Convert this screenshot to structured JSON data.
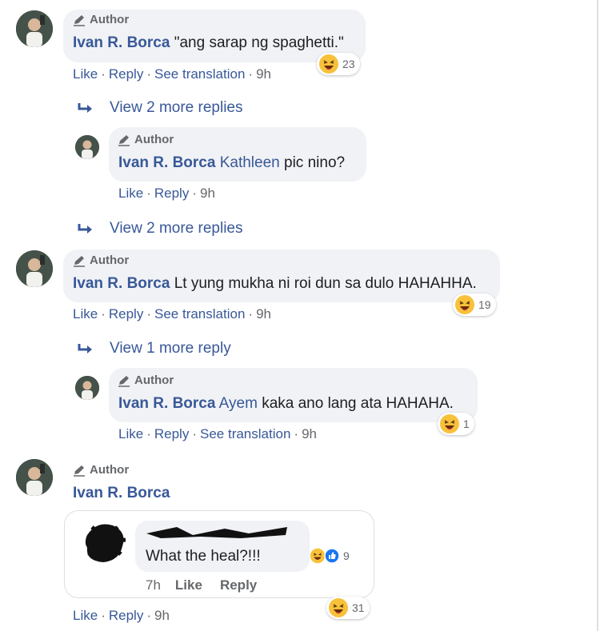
{
  "labels": {
    "author": "Author",
    "like": "Like",
    "reply": "Reply",
    "see_translation": "See translation",
    "sep": "·"
  },
  "comments": [
    {
      "name": "Ivan R. Borca",
      "mention": "",
      "text": "\"ang sarap ng spaghetti.\"",
      "time": "9h",
      "reaction_count": "23",
      "view_more": "View 2 more replies"
    },
    {
      "name": "Ivan R. Borca",
      "mention": "Kathleen",
      "text": "pic nino?",
      "time": "9h",
      "reaction_count": "",
      "view_more": "View 2 more replies"
    },
    {
      "name": "Ivan R. Borca",
      "mention": "",
      "text": "Lt yung mukha ni roi dun sa dulo HAHAHHA.",
      "time": "9h",
      "reaction_count": "19",
      "view_more": "View 1 more reply"
    },
    {
      "name": "Ivan R. Borca",
      "mention": "Ayem",
      "text": "kaka ano lang ata HAHAHA.",
      "time": "9h",
      "reaction_count": "1",
      "view_more": ""
    },
    {
      "name": "Ivan R. Borca",
      "mention": "",
      "text": "",
      "time": "9h",
      "reaction_count": "31",
      "view_more": ""
    }
  ],
  "shared": {
    "text": "What the heal?!!!",
    "time": "7h",
    "like": "Like",
    "reply": "Reply",
    "reaction_count": "9"
  },
  "icons": {
    "author": "pencil-icon",
    "reply_arrow": "reply-arrow-icon",
    "haha": "haha-reaction-icon",
    "like": "like-reaction-icon"
  },
  "colors": {
    "link": "#385898",
    "bubble": "#f0f2f5",
    "meta": "#65676b",
    "like_blue": "#1877f2",
    "haha_yellow": "#f7c13a"
  }
}
